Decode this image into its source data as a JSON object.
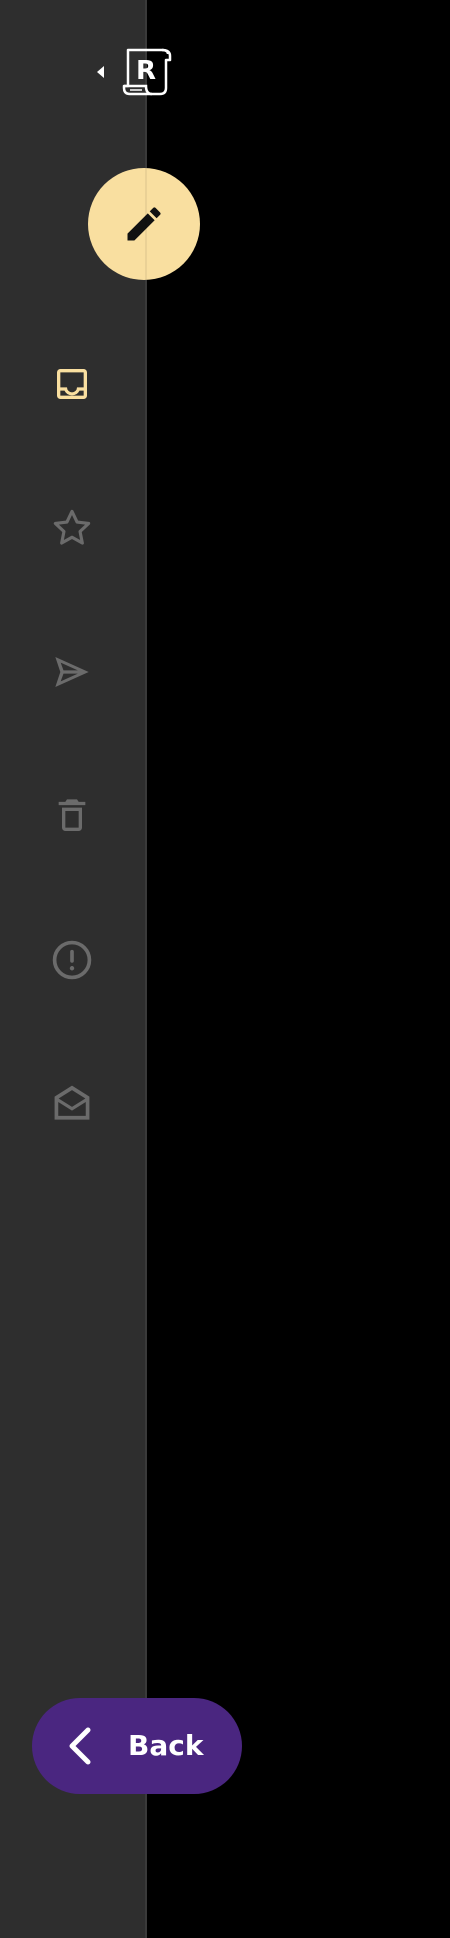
{
  "colors": {
    "sidebar_bg": "#2e2e2e",
    "content_bg": "#000000",
    "accent": "#f9dfa0",
    "icon_muted": "#6b6b6b",
    "back_button_bg": "#4a2680",
    "back_button_text": "#ffffff"
  },
  "logo": {
    "letter": "R",
    "icon": "scroll-logo-icon"
  },
  "sidebar": {
    "collapse_icon": "caret-left-icon",
    "compose_icon": "pencil-icon",
    "items": [
      {
        "icon": "inbox-icon",
        "active": true
      },
      {
        "icon": "star-icon",
        "active": false
      },
      {
        "icon": "send-icon",
        "active": false
      },
      {
        "icon": "trash-icon",
        "active": false
      },
      {
        "icon": "alert-circle-icon",
        "active": false
      },
      {
        "icon": "envelope-open-icon",
        "active": false
      }
    ]
  },
  "back_button": {
    "label": "Back",
    "icon": "chevron-left-icon"
  }
}
